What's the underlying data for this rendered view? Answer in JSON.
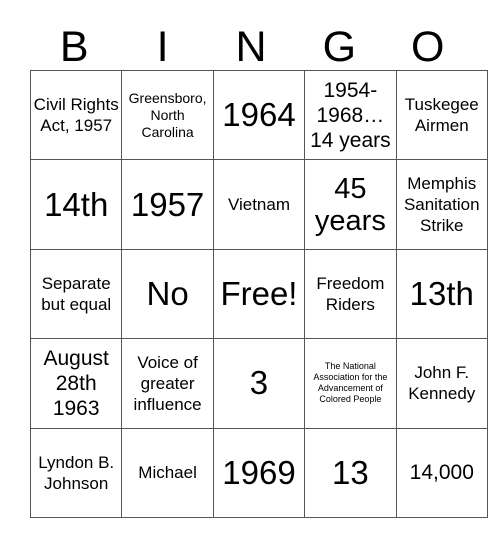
{
  "card": {
    "title": "BINGO",
    "header_letters": [
      "B",
      "I",
      "N",
      "G",
      "O"
    ],
    "grid_colors": {
      "border": "#555555",
      "text": "#000000",
      "background": "#ffffff"
    },
    "rows": [
      {
        "cells": [
          {
            "text": "Civil Rights Act, 1957",
            "size": "md"
          },
          {
            "text": "Greensboro, North Carolina",
            "size": "sm"
          },
          {
            "text": "1964",
            "size": "xxl"
          },
          {
            "text": "1954-1968… 14 years",
            "size": "lg"
          },
          {
            "text": "Tuskegee Airmen",
            "size": "md"
          }
        ]
      },
      {
        "cells": [
          {
            "text": "14th",
            "size": "xxl"
          },
          {
            "text": "1957",
            "size": "xxl"
          },
          {
            "text": "Vietnam",
            "size": "md"
          },
          {
            "text": "45 years",
            "size": "xl"
          },
          {
            "text": "Memphis Sanitation Strike",
            "size": "md"
          }
        ]
      },
      {
        "cells": [
          {
            "text": "Separate but equal",
            "size": "md"
          },
          {
            "text": "No",
            "size": "xxl"
          },
          {
            "text": "Free!",
            "size": "xxl"
          },
          {
            "text": "Freedom Riders",
            "size": "md"
          },
          {
            "text": "13th",
            "size": "xxl"
          }
        ]
      },
      {
        "cells": [
          {
            "text": "August 28th 1963",
            "size": "lg"
          },
          {
            "text": "Voice of greater influence",
            "size": "md"
          },
          {
            "text": "3",
            "size": "xxl"
          },
          {
            "text": "The National Association for the Advancement of Colored People",
            "size": "xs"
          },
          {
            "text": "John F. Kennedy",
            "size": "md"
          }
        ]
      },
      {
        "cells": [
          {
            "text": "Lyndon B. Johnson",
            "size": "md"
          },
          {
            "text": "Michael",
            "size": "md"
          },
          {
            "text": "1969",
            "size": "xxl"
          },
          {
            "text": "13",
            "size": "xxl"
          },
          {
            "text": "14,000",
            "size": "lg"
          }
        ]
      }
    ]
  }
}
